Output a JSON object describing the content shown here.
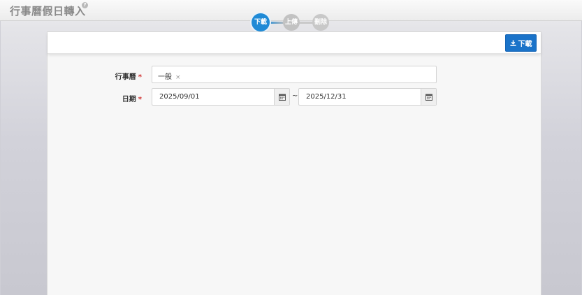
{
  "header": {
    "title": "行事曆假日轉入",
    "help_glyph": "?"
  },
  "steps": [
    {
      "label": "下載",
      "active": true
    },
    {
      "label": "上傳",
      "active": false
    },
    {
      "label": "刪除",
      "active": false
    }
  ],
  "toolbar": {
    "download_label": "下載",
    "accent_color": "#1a73c9"
  },
  "form": {
    "calendar": {
      "label": "行事曆",
      "required_mark": "*",
      "selected_tag": "一般",
      "remove_glyph": "×"
    },
    "date": {
      "label": "日期",
      "required_mark": "*",
      "start": "2025/09/01",
      "separator": "~",
      "end": "2025/12/31"
    }
  }
}
